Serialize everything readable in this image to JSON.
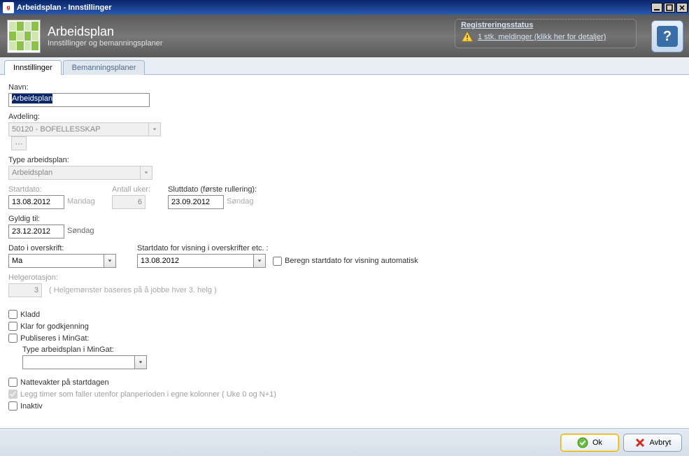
{
  "window": {
    "title": "Arbeidsplan - Innstillinger"
  },
  "header": {
    "title": "Arbeidsplan",
    "subtitle": "Innstillinger og bemanningsplaner",
    "reg_status_title": "Registreringsstatus",
    "reg_status_link": "1 stk. meldinger (klikk her for detaljer)",
    "help_symbol": "?"
  },
  "tabs": {
    "t0": "Innstillinger",
    "t1": "Bemanningsplaner"
  },
  "form": {
    "navn_label": "Navn:",
    "navn_value": "Arbeidsplan",
    "avdeling_label": "Avdeling:",
    "avdeling_value": "50120 - BOFELLESSKAP",
    "type_label": "Type arbeidsplan:",
    "type_value": "Arbeidsplan",
    "startdato_label": "Startdato:",
    "startdato_value": "13.08.2012",
    "startdato_day": "Mandag",
    "antall_uker_label": "Antall uker:",
    "antall_uker_value": "6",
    "sluttdato_label": "Sluttdato (første rullering):",
    "sluttdato_value": "23.09.2012",
    "sluttdato_day": "Søndag",
    "gyldig_label": "Gyldig til:",
    "gyldig_value": "23.12.2012",
    "gyldig_day": "Søndag",
    "dato_overskrift_label": "Dato i overskrift:",
    "dato_overskrift_value": "Ma",
    "startdato_visning_label": "Startdato for visning i overskrifter etc. :",
    "startdato_visning_value": "13.08.2012",
    "beregn_label": "Beregn startdato for visning automatisk",
    "helg_label": "Helgerotasjon:",
    "helg_value": "3",
    "helg_hint": "( Helgemønster baseres på å jobbe hver 3. helg )",
    "kladd": "Kladd",
    "klar": "Klar for godkjenning",
    "publiseres": "Publiseres i MinGat:",
    "type_mingat": "Type arbeidsplan i MinGat:",
    "nattevakter": "Nattevakter på startdagen",
    "legg_timer": "Legg timer som faller utenfor planperioden i egne kolonner ( Uke 0 og N+1)",
    "inaktiv": "Inaktiv"
  },
  "footer": {
    "ok": "Ok",
    "avbryt": "Avbryt"
  }
}
